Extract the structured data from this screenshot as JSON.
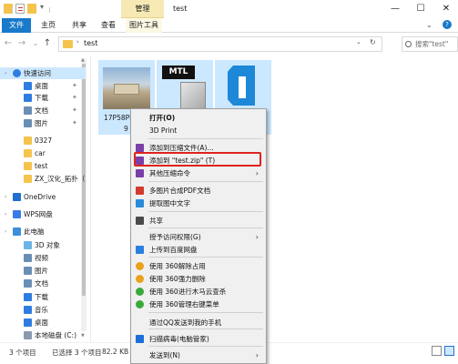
{
  "titlebar": {
    "context_tab": "管理",
    "title": "test",
    "controls": {
      "minimize": "—",
      "maximize": "☐",
      "close": "✕"
    }
  },
  "tabs": [
    "文件",
    "主页",
    "共享",
    "查看",
    "图片工具"
  ],
  "nav": {
    "back": "←",
    "forward": "→",
    "recent": "⌄",
    "up": "↑",
    "path": "test",
    "refresh": "↻",
    "search_placeholder": "搜索\"test\""
  },
  "sidebar": {
    "items": [
      {
        "label": "快速访问",
        "icon": "star-icon",
        "color": "#2f7de1",
        "pinned": false
      },
      {
        "label": "桌面",
        "icon": "desktop-icon",
        "color": "#2f7de1",
        "pinned": true
      },
      {
        "label": "下载",
        "icon": "download-icon",
        "color": "#2f7de1",
        "pinned": true
      },
      {
        "label": "文档",
        "icon": "document-icon",
        "color": "#6a8fb5",
        "pinned": true
      },
      {
        "label": "图片",
        "icon": "pictures-icon",
        "color": "#6a8fb5",
        "pinned": true
      },
      {
        "label": "0327",
        "icon": "folder-icon",
        "color": "#f5c44d",
        "pinned": false
      },
      {
        "label": "car",
        "icon": "folder-icon",
        "color": "#f5c44d",
        "pinned": false
      },
      {
        "label": "test",
        "icon": "folder-icon",
        "color": "#f5c44d",
        "pinned": false
      },
      {
        "label": "ZX_汉化_拓扑（",
        "icon": "folder-icon",
        "color": "#f5c44d",
        "pinned": false
      },
      {
        "label": "OneDrive",
        "icon": "cloud-icon",
        "color": "#1f6fd0",
        "pinned": false
      },
      {
        "label": "WPS网盘",
        "icon": "cloud-icon",
        "color": "#3b7be8",
        "pinned": false
      },
      {
        "label": "此电脑",
        "icon": "computer-icon",
        "color": "#3c8fd9",
        "pinned": false
      },
      {
        "label": "3D 对象",
        "icon": "cube-icon",
        "color": "#6db4e6",
        "pinned": false
      },
      {
        "label": "视频",
        "icon": "video-icon",
        "color": "#6a8fb5",
        "pinned": false
      },
      {
        "label": "图片",
        "icon": "pictures-icon",
        "color": "#6a8fb5",
        "pinned": false
      },
      {
        "label": "文档",
        "icon": "document-icon",
        "color": "#6a8fb5",
        "pinned": false
      },
      {
        "label": "下载",
        "icon": "download-icon",
        "color": "#2f7de1",
        "pinned": false
      },
      {
        "label": "音乐",
        "icon": "music-icon",
        "color": "#2f7de1",
        "pinned": false
      },
      {
        "label": "桌面",
        "icon": "desktop-icon",
        "color": "#2f7de1",
        "pinned": false
      },
      {
        "label": "本地磁盘 (C:)",
        "icon": "drive-icon",
        "color": "#8a9bb0",
        "pinned": false
      }
    ]
  },
  "files": [
    {
      "label": "17P58PI",
      "sub": "9",
      "icon": "image-thumbnail-icon"
    },
    {
      "label": "",
      "sub": "",
      "icon": "mtl-file-icon",
      "badge": "MTL"
    },
    {
      "label": "",
      "sub": "",
      "icon": "obj-file-icon"
    }
  ],
  "status": {
    "count": "3 个项目",
    "selected": "已选择 3 个项目",
    "size": "82.2 KB"
  },
  "context_menu": {
    "items": [
      {
        "label": "打开(O)",
        "bold": true,
        "icon": "",
        "submenu": false
      },
      {
        "label": "3D Print",
        "icon": "",
        "submenu": false
      },
      {
        "label": "添加到压缩文件(A)...",
        "icon": "winrar-icon",
        "submenu": false
      },
      {
        "label": "添加到 \"test.zip\" (T)",
        "icon": "winrar-icon",
        "submenu": false
      },
      {
        "label": "其他压缩命令",
        "icon": "winrar-icon",
        "submenu": true
      },
      {
        "label": "多图片合成PDF文档",
        "icon": "pdf-icon",
        "submenu": false
      },
      {
        "label": "提取图中文字",
        "icon": "text-extract-icon",
        "submenu": false
      },
      {
        "label": "共享",
        "icon": "share-icon",
        "submenu": false
      },
      {
        "label": "授予访问权限(G)",
        "icon": "",
        "submenu": true
      },
      {
        "label": "上传到百度网盘",
        "icon": "baidu-icon",
        "submenu": false
      },
      {
        "label": "使用 360解除占用",
        "icon": "360-unlock-icon",
        "submenu": false
      },
      {
        "label": "使用 360强力删除",
        "icon": "360-delete-icon",
        "submenu": false
      },
      {
        "label": "使用 360进行木马云查杀",
        "icon": "360-scan-icon",
        "submenu": false
      },
      {
        "label": "使用 360管理右键菜单",
        "icon": "360-menu-icon",
        "submenu": false
      },
      {
        "label": "通过QQ发送到我的手机",
        "icon": "",
        "submenu": false
      },
      {
        "label": "扫描病毒(电脑管家)",
        "icon": "shield-icon",
        "submenu": false
      },
      {
        "label": "发送到(N)",
        "icon": "",
        "submenu": true
      }
    ],
    "submenu_arrow": "›",
    "highlight_color": "#e0221e"
  }
}
